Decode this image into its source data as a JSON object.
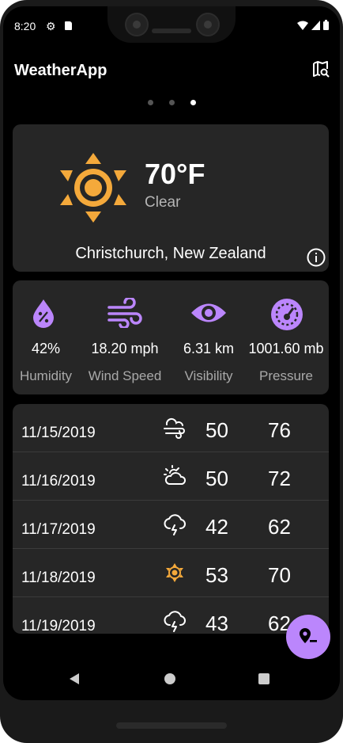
{
  "status_bar": {
    "time": "8:20",
    "icons": [
      "settings-icon",
      "sd-card-icon",
      "wifi-icon",
      "signal-icon",
      "battery-icon"
    ]
  },
  "app_bar": {
    "title": "WeatherApp",
    "action_icon": "map-search-icon"
  },
  "pager": {
    "count": 3,
    "active_index": 2
  },
  "current": {
    "temperature": "70°F",
    "condition": "Clear",
    "location": "Christchurch, New Zealand",
    "icon": "sun-icon",
    "info_icon": "info-icon"
  },
  "stats": [
    {
      "value": "42%",
      "label": "Humidity",
      "icon": "humidity-icon"
    },
    {
      "value": "18.20 mph",
      "label": "Wind Speed",
      "icon": "wind-icon"
    },
    {
      "value": "6.31 km",
      "label": "Visibility",
      "icon": "eye-icon"
    },
    {
      "value": "1001.60 mb",
      "label": "Pressure",
      "icon": "gauge-icon"
    }
  ],
  "forecast": [
    {
      "date": "11/15/2019",
      "low": "50",
      "high": "76",
      "icon": "windy-cloud-icon"
    },
    {
      "date": "11/16/2019",
      "low": "50",
      "high": "72",
      "icon": "partly-cloudy-icon"
    },
    {
      "date": "11/17/2019",
      "low": "42",
      "high": "62",
      "icon": "rain-cloud-icon"
    },
    {
      "date": "11/18/2019",
      "low": "53",
      "high": "70",
      "icon": "sun-icon"
    },
    {
      "date": "11/19/2019",
      "low": "43",
      "high": "62",
      "icon": "rain-cloud-icon"
    }
  ],
  "fab": {
    "icon": "remove-location-icon"
  },
  "colors": {
    "accent": "#bb86fc",
    "sun": "#f4a93b",
    "card": "#262626",
    "background": "#000000"
  }
}
